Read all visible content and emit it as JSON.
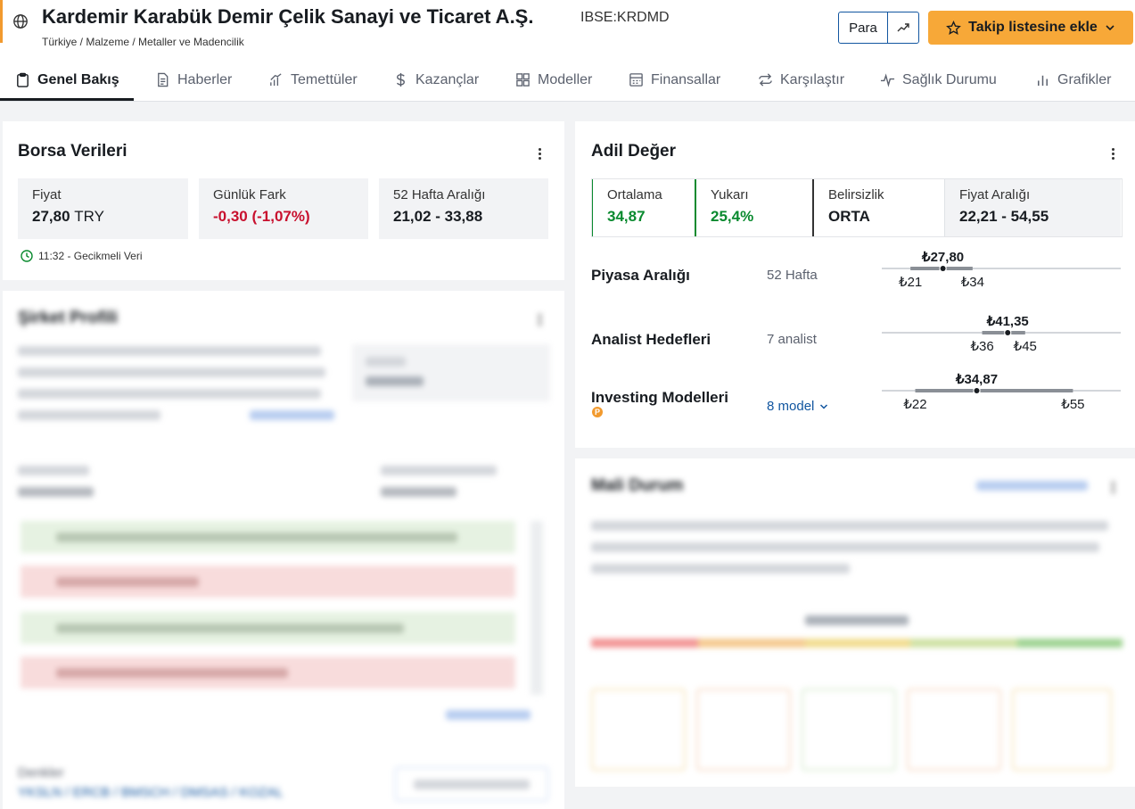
{
  "header": {
    "company_name": "Kardemir Karabük Demir Çelik Sanayi ve Ticaret A.Ş.",
    "ticker": "IBSE:KRDMD",
    "breadcrumb": "Türkiye / Malzeme / Metaller ve Madencilik",
    "currency_button": "Para",
    "watchlist_button": "Takip listesine ekle",
    "accent_color": "#f7a838"
  },
  "tabs": [
    {
      "label": "Genel Bakış",
      "icon": "clipboard-icon",
      "active": true
    },
    {
      "label": "Haberler",
      "icon": "document-icon"
    },
    {
      "label": "Temettüler",
      "icon": "growth-icon"
    },
    {
      "label": "Kazançlar",
      "icon": "dollar-icon"
    },
    {
      "label": "Modeller",
      "icon": "grid-icon"
    },
    {
      "label": "Finansallar",
      "icon": "calculator-icon"
    },
    {
      "label": "Karşılaştır",
      "icon": "compare-icon"
    },
    {
      "label": "Sağlık Durumu",
      "icon": "pulse-icon"
    },
    {
      "label": "Grafikler",
      "icon": "bar-chart-icon"
    }
  ],
  "market_data": {
    "title": "Borsa Verileri",
    "price_label": "Fiyat",
    "price_value": "27,80",
    "price_currency": "TRY",
    "daily_change_label": "Günlük Fark",
    "daily_change_value": "-0,30 (-1,07%)",
    "range_label": "52 Hafta Aralığı",
    "range_value": "21,02 - 33,88",
    "delay_note": "11:32 - Gecikmeli Veri"
  },
  "fair_value": {
    "title": "Adil Değer",
    "average_label": "Ortalama",
    "average_value": "34,87",
    "upside_label": "Yukarı",
    "upside_value": "25,4%",
    "uncertainty_label": "Belirsizlik",
    "uncertainty_value": "ORTA",
    "price_range_label": "Fiyat Aralığı",
    "price_range_value": "22,21 - 54,55",
    "rows": [
      {
        "label": "Piyasa Aralığı",
        "sub": "52 Hafta",
        "current": "₺27,80",
        "low": "₺21",
        "high": "₺34",
        "range_low": 21,
        "range_high": 34,
        "marker": 27.8
      },
      {
        "label": "Analist Hedefleri",
        "sub": "7 analist",
        "current": "₺41,35",
        "low": "₺36",
        "high": "₺45",
        "range_low": 36,
        "range_high": 45,
        "marker": 41.35
      },
      {
        "label": "Investing Modelleri",
        "sub": "8 model",
        "current": "₺34,87",
        "low": "₺22",
        "high": "₺55",
        "range_low": 22,
        "range_high": 55,
        "marker": 34.87
      }
    ]
  },
  "company_profile": {
    "title": "Şirket Profili",
    "peers_label": "Denkler",
    "peers": [
      "YKSLN",
      "ERCB",
      "BMSCH",
      "DMSAS",
      "KOZAL"
    ]
  },
  "financial_health": {
    "title": "Mali Durum"
  },
  "colors": {
    "positive": "#0a8a2f",
    "negative": "#c8102e",
    "link": "#1256a0"
  }
}
